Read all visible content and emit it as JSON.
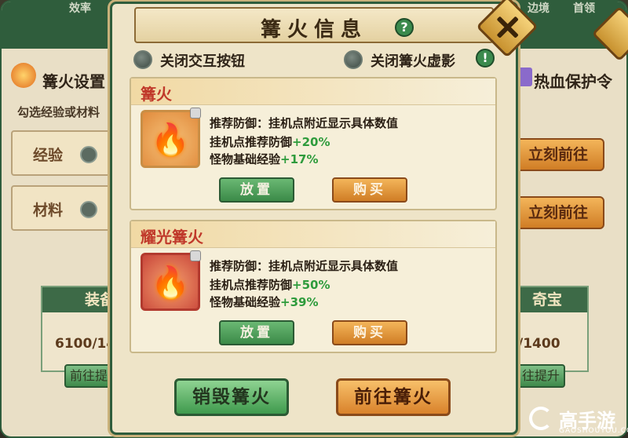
{
  "background": {
    "top_left": "效率",
    "top_right_1": "边境",
    "top_right_2": "首领",
    "left_header": "篝火设置",
    "left_hint": "勾选经验或材料",
    "row1_label": "经验",
    "row2_label": "材料",
    "right_header": "热血保护令",
    "go_label": "立刻前往",
    "card_left_title": "装备",
    "card_left_value": "6100/14",
    "card_left_btn": "前往提",
    "card_right_title": "奇宝",
    "card_right_value": "/1400",
    "card_right_btn": "往提升"
  },
  "modal": {
    "title": "篝火信息",
    "help_icon": "?",
    "warn_icon": "!",
    "toggle_interact": "关闭交互按钮",
    "toggle_shadow": "关闭篝火虚影",
    "items": [
      {
        "name": "篝火",
        "line1": "推荐防御：挂机点附近显示具体数值",
        "line2_label": "挂机点推荐防御",
        "line2_value": "+20%",
        "line3_label": "怪物基础经验",
        "line3_value": "+17%",
        "place": "放置",
        "buy": "购买"
      },
      {
        "name": "耀光篝火",
        "line1": "推荐防御：挂机点附近显示具体数值",
        "line2_label": "挂机点推荐防御",
        "line2_value": "+50%",
        "line3_label": "怪物基础经验",
        "line3_value": "+39%",
        "place": "放置",
        "buy": "购买"
      }
    ],
    "destroy": "销毁篝火",
    "goto": "前往篝火"
  },
  "watermark": {
    "name": "高手游",
    "domain": "GAOSHOUYOU.COM"
  }
}
